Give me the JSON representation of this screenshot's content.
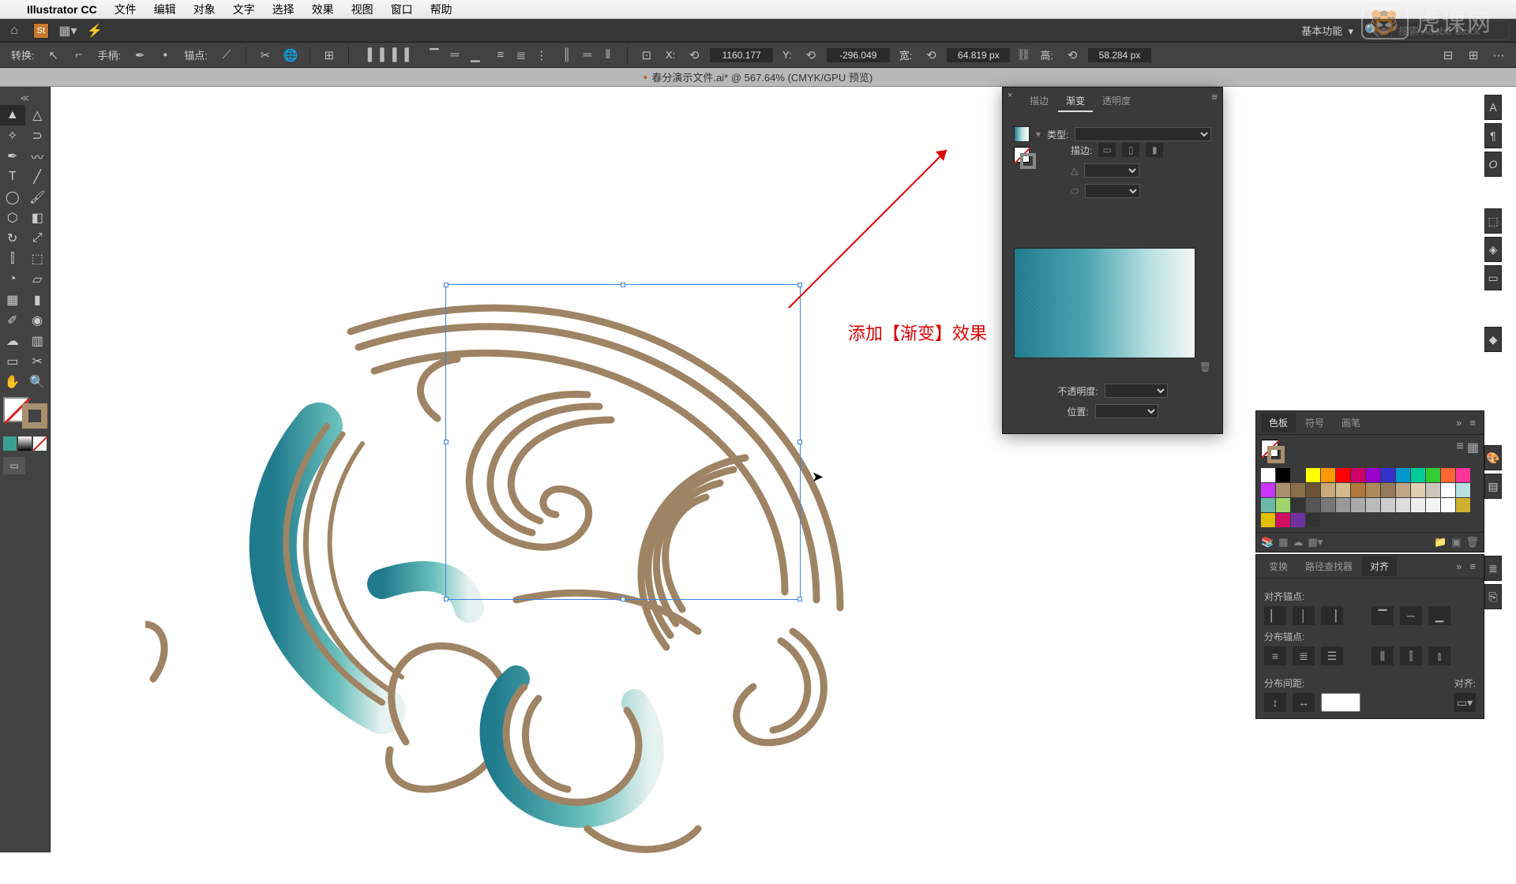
{
  "menubar": {
    "app": "Illustrator CC",
    "items": [
      "文件",
      "编辑",
      "对象",
      "文字",
      "选择",
      "效果",
      "视图",
      "窗口",
      "帮助"
    ]
  },
  "appbar": {
    "workspace": "基本功能",
    "search_placeholder": "搜索 Adobe Stock"
  },
  "controlbar": {
    "transform": "转换:",
    "handle": "手柄:",
    "anchor": "锚点:",
    "x_label": "X:",
    "x_value": "1160.177",
    "y_label": "Y:",
    "y_value": "-296.049",
    "w_label": "宽:",
    "w_value": "64.819 px",
    "h_label": "高:",
    "h_value": "58.284 px"
  },
  "doc": {
    "title": "春分演示文件.ai* @ 567.64% (CMYK/GPU 预览)"
  },
  "annotation": "添加【渐变】效果",
  "gradient_panel": {
    "tabs": [
      "描边",
      "渐变",
      "透明度"
    ],
    "type_label": "类型:",
    "stroke_label": "描边:",
    "opacity_label": "不透明度:",
    "position_label": "位置:"
  },
  "swatch_panel": {
    "tabs": [
      "色板",
      "符号",
      "画笔"
    ]
  },
  "align_panel": {
    "tabs": [
      "变换",
      "路径查找器",
      "对齐"
    ],
    "align_anchor": "对齐锚点:",
    "dist_anchor": "分布锚点:",
    "dist_spacing": "分布间距:",
    "align_to": "对齐:"
  },
  "swatch_colors": [
    "#ffffff",
    "#000000",
    "#3a3a3a",
    "#ffff00",
    "#ff9900",
    "#ff0000",
    "#cc0066",
    "#9900cc",
    "#3333cc",
    "#0099cc",
    "#00cc99",
    "#33cc33",
    "#ff6633",
    "#ff3399",
    "#cc33ff",
    "#a88f6e",
    "#8a6f4a",
    "#6b5336",
    "#c9a97a",
    "#d4bb8e",
    "#b0763a",
    "#ad8a5c",
    "#947a5a",
    "#bfa686",
    "#e0d0b0",
    "#ccc6bd",
    "#ffffff",
    "#b8e0e0",
    "#6bbaa8",
    "#9ed66b",
    "#333333",
    "#555555",
    "#777777",
    "#999999",
    "#aaaaaa",
    "#bbbbbb",
    "#cccccc",
    "#dddddd",
    "#eeeeee",
    "#f5f5f5",
    "#ffffff",
    "#d0b030",
    "#e0c000",
    "#d01060",
    "#7030a0",
    "#333333"
  ],
  "watermark": "虎课网"
}
